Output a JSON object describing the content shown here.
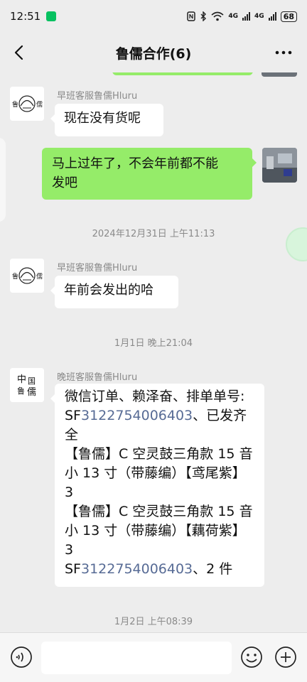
{
  "status_bar": {
    "time": "12:51",
    "network_1": "4G",
    "network_2": "4G",
    "battery": "68"
  },
  "header": {
    "title": "鲁儒合作(6)"
  },
  "messages": [
    {
      "sender": "早班客服鲁儒Hluru",
      "text": "现在没有货呢"
    },
    {
      "line1": "马上过年了，不会年前都不能",
      "line2": "发吧"
    },
    {
      "timestamp": "2024年12月31日 上午11:13"
    },
    {
      "sender": "早班客服鲁儒Hluru",
      "text": "年前会发出的哈"
    },
    {
      "timestamp": "1月1日 晚上21:04"
    },
    {
      "sender": "晚班客服鲁儒Hluru",
      "lines": [
        "微信订单、赖泽奋、排单单号:",
        "SF",
        "3122754006403",
        "、已发齐",
        "全",
        "【鲁儒】C 空灵鼓三角款 15 音",
        "小 13 寸（带藤编）【鸢尾紫】",
        "3",
        "【鲁儒】C 空灵鼓三角款 15 音",
        "小 13 寸（带藤编）【藕荷紫】",
        "3",
        "SF",
        "3122754006403",
        "、2 件"
      ]
    },
    {
      "timestamp": "1月2日 上午08:39"
    }
  ],
  "avatar_brand": {
    "left": "鲁",
    "right": "儒",
    "night_1": "中",
    "night_2": "国",
    "night_3": "鲁",
    "night_4": "儒"
  },
  "colors": {
    "outgoing_bubble": "#95ec69",
    "link": "#576b95",
    "background": "#ededed"
  }
}
